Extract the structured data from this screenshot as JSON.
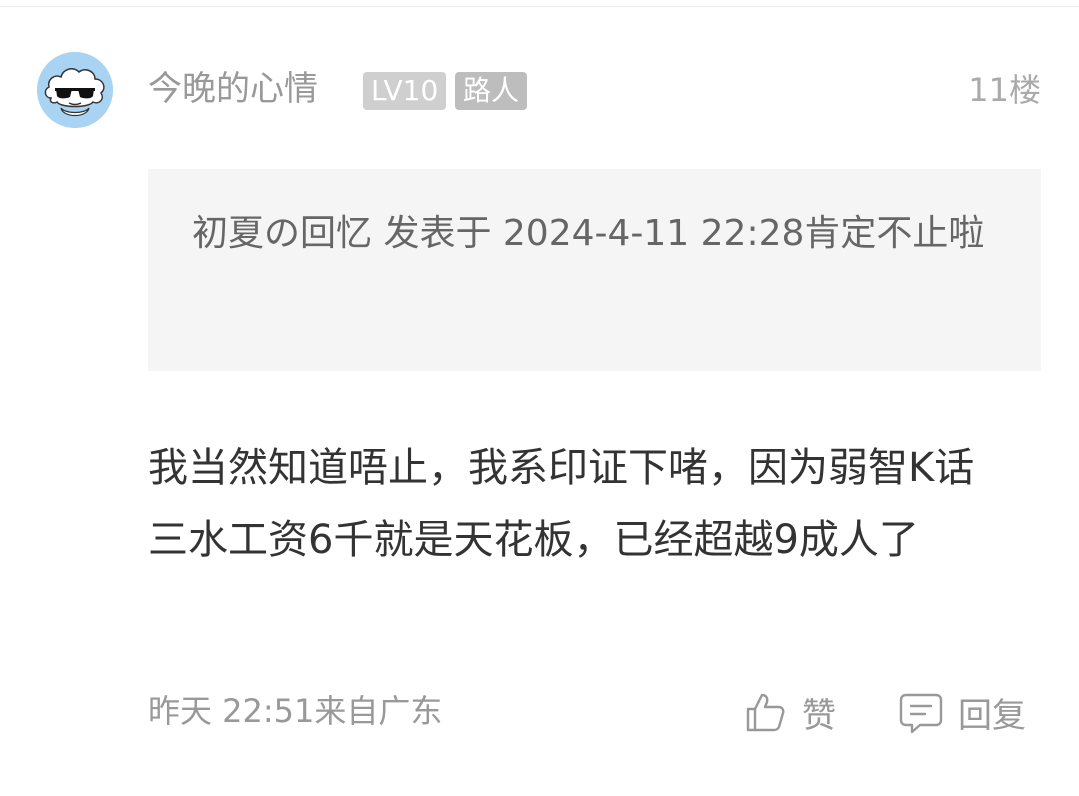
{
  "comment": {
    "user": {
      "name": "今晚的心情",
      "level": "LV10",
      "role": "路人",
      "avatar": "cloud-sunglasses-avatar"
    },
    "floor": "11楼",
    "quote": {
      "text": "初夏の回忆 发表于 2024-4-11 22:28肯定不止啦"
    },
    "body": "我当然知道唔止，我系印证下啫，因为弱智K话三水工资6千就是天花板，已经超越9成人了",
    "meta": "昨天 22:51来自广东",
    "actions": {
      "like_label": "赞",
      "like_icon": "thumbs-up-icon",
      "reply_label": "回复",
      "reply_icon": "speech-bubble-icon"
    }
  },
  "colors": {
    "quote_bg": "#f5f5f5",
    "muted_text": "#999999",
    "body_text": "#333333",
    "badge_gray": "#cfcfcf"
  }
}
